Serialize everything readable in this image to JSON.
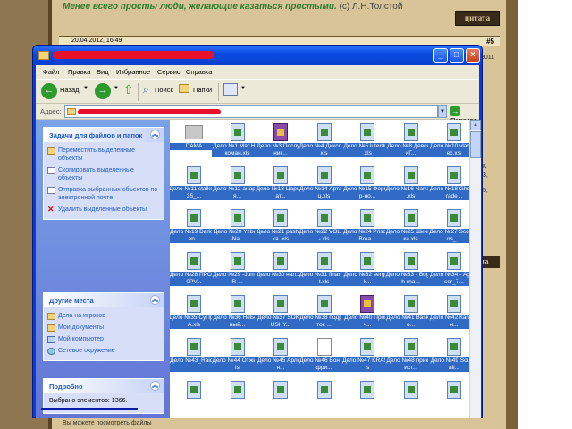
{
  "forum": {
    "quote": "Менее всего просты люди, желающие казаться простыми.",
    "quote_author": "(с) Л.Н.Толстой",
    "citata_label": "цитата",
    "post_date": "20.04.2012, 16:49",
    "post_number": "#5",
    "side_texts": [
      "2011",
      "К",
      "3,",
      "5,"
    ],
    "citata_label_2": "цитата",
    "bottom_text": "Вы можете посмотреть файлы"
  },
  "window": {
    "menu": [
      "Файл",
      "Правка",
      "Вид",
      "Избранное",
      "Сервис",
      "Справка"
    ],
    "toolbar": {
      "back": "Назад",
      "search": "Поиск",
      "folders": "Папки"
    },
    "address_label": "Адрес:",
    "go_label": "Переход",
    "tasks_panel": {
      "title": "Задачи для файлов и папок",
      "items": [
        "Переместить выделенные объекты",
        "Скопировать выделенные объекты",
        "Отправка выбранных объектов по электронной почте",
        "Удалить выделенные объекты"
      ]
    },
    "places_panel": {
      "title": "Другие места",
      "items": [
        "Дела на игроков",
        "Мои документы",
        "Мой компьютер",
        "Сетевое окружение"
      ]
    },
    "details_panel": {
      "title": "Подробно",
      "text": "Выбрано элементов: 1366."
    },
    "files": [
      {
        "name": "DAMA",
        "kind": "folder"
      },
      {
        "name": "Дело №1 Mar Наркоман.xls",
        "kind": "xls"
      },
      {
        "name": "Дело №3 Послушник...",
        "kind": "rar"
      },
      {
        "name": "Дело №4 Диксоть.xls",
        "kind": "xls"
      },
      {
        "name": "Дело №5 luter007 .xls",
        "kind": "xls"
      },
      {
        "name": "Дело №8 ДевснНиГ...",
        "kind": "xls"
      },
      {
        "name": "Дело №10 vlad ariec.xls",
        "kind": "xls"
      },
      {
        "name": "Дело №11 stalker135_...",
        "kind": "xls"
      },
      {
        "name": "Дело №12 анархия...",
        "kind": "xls"
      },
      {
        "name": "Дело №13 Царь Бат...",
        "kind": "xls"
      },
      {
        "name": "Дело №14 Артанец.xls",
        "kind": "xls"
      },
      {
        "name": "Дело №15 Фермер-но...",
        "kind": "xls"
      },
      {
        "name": "Дело №16 Narralin .xls",
        "kind": "xls"
      },
      {
        "name": "Дело №18 GhostTrade...",
        "kind": "xls"
      },
      {
        "name": "Дело №19 Dark-laen...",
        "kind": "xls"
      },
      {
        "name": "Дело №20 Yzbek, -Na...",
        "kind": "xls"
      },
      {
        "name": "Дело №21 pashka ka..xls",
        "kind": "xls"
      },
      {
        "name": "Дело №22 VOLNA-.xls",
        "kind": "xls"
      },
      {
        "name": "Дело №24 Prison-Brea...",
        "kind": "xls"
      },
      {
        "name": "Дело №25 Шиншика.xls",
        "kind": "xls"
      },
      {
        "name": "Дело №27 Scorpions_...",
        "kind": "xls"
      },
      {
        "name": "Дело №28 ПРО100РV...",
        "kind": "xls"
      },
      {
        "name": "Дело №29 -JumpeR-...",
        "kind": "xls"
      },
      {
        "name": "Дело №30 нал.xls",
        "kind": "xls"
      },
      {
        "name": "Дело №31 finansist.xls",
        "kind": "xls"
      },
      {
        "name": "Дело №32 sergey k...",
        "kind": "xls"
      },
      {
        "name": "Дело №33 - Bogush-rna...",
        "kind": "xls"
      },
      {
        "name": "Дело №34 - Agressor_7...",
        "kind": "xls"
      },
      {
        "name": "Дело №35 СуПрУгА.xls",
        "kind": "xls"
      },
      {
        "name": "Дело №36 НеБеСный...",
        "kind": "xls"
      },
      {
        "name": "Дело №37 SOKRUSHY...",
        "kind": "xls"
      },
      {
        "name": "Дело №38 подросток ...",
        "kind": "xls"
      },
      {
        "name": "Дело №40 Прокач...",
        "kind": "rar"
      },
      {
        "name": "Дело №41 Baskako...",
        "kind": "xls"
      },
      {
        "name": "Дело №42 Капитан...",
        "kind": "xls"
      },
      {
        "name": "Дело №43_Raid...",
        "kind": "xls"
      },
      {
        "name": "Дело №44 Отжиг.xls",
        "kind": "xls"
      },
      {
        "name": "Дело №45 Арлеан...",
        "kind": "xls"
      },
      {
        "name": "Дело №46 Вон Дефри...",
        "kind": "plain"
      },
      {
        "name": "Дело №47 KRAS.xls",
        "kind": "xls"
      },
      {
        "name": "Дело №48 приколист...",
        "kind": "xls"
      },
      {
        "name": "Дело №49 Soul Cali...",
        "kind": "xls"
      },
      {
        "name": "",
        "kind": "xls"
      },
      {
        "name": "",
        "kind": "xls"
      },
      {
        "name": "",
        "kind": "xls"
      },
      {
        "name": "",
        "kind": "xls"
      },
      {
        "name": "",
        "kind": "xls"
      },
      {
        "name": "",
        "kind": "xls"
      },
      {
        "name": "",
        "kind": "xls"
      }
    ]
  }
}
